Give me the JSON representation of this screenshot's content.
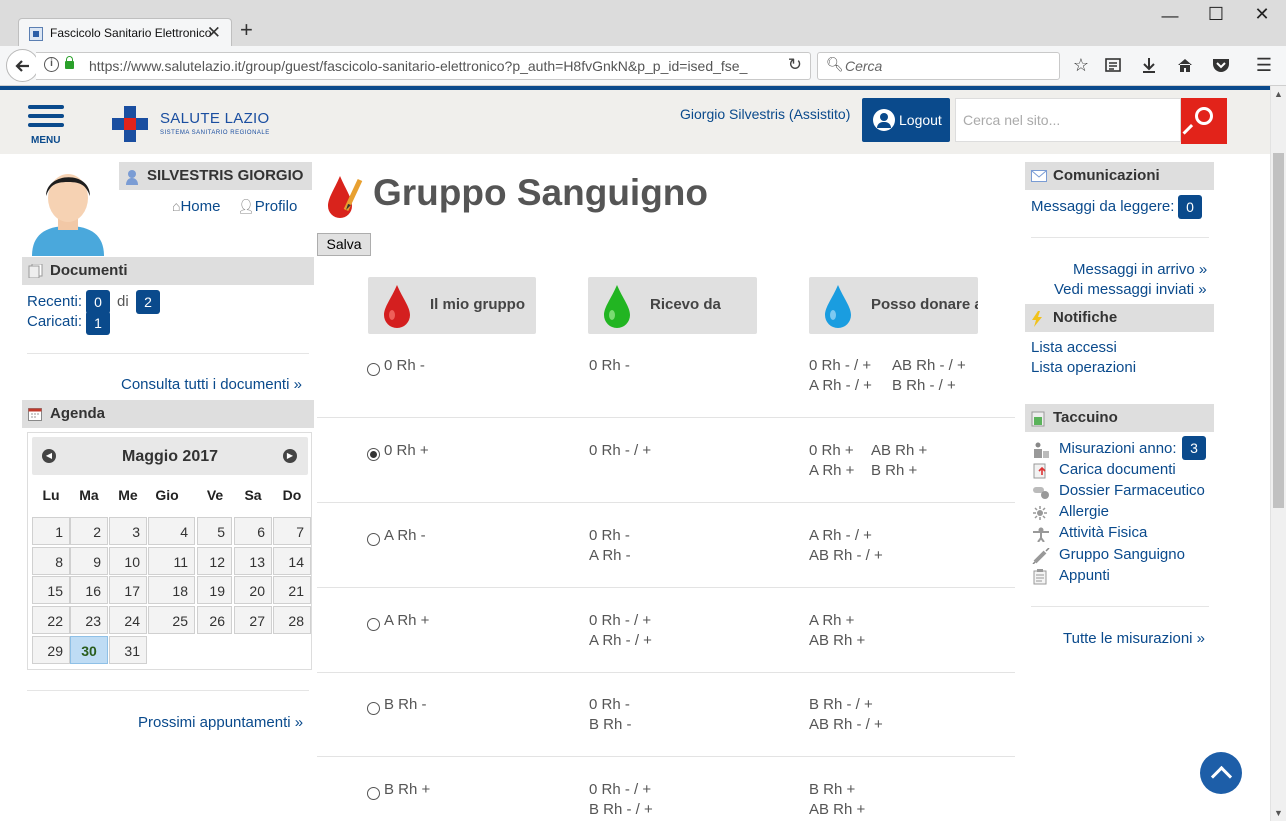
{
  "browser": {
    "tab_title": "Fascicolo Sanitario Elettronico",
    "new_tab": "+",
    "url": "https://www.salutelazio.it/group/guest/fascicolo-sanitario-elettronico?p_auth=H8fvGnkN&p_p_id=ised_fse_",
    "search_placeholder": "Cerca",
    "window_controls": [
      "minimize",
      "maximize",
      "close"
    ]
  },
  "header": {
    "menu_label": "MENU",
    "logo_title": "SALUTE LAZIO",
    "logo_subtitle": "SISTEMA SANITARIO REGIONALE",
    "user_name": "Giorgio Silvestris (Assistito)",
    "logout_label": "Logout",
    "site_search_placeholder": "Cerca nel sito..."
  },
  "profile": {
    "name": "SILVESTRIS GIORGIO",
    "home_link": "Home",
    "profile_link": "Profilo"
  },
  "documenti": {
    "title": "Documenti",
    "recent_label": "Recenti:",
    "recent_count": "0",
    "of_label": "di",
    "total_count": "2",
    "uploaded_label": "Caricati:",
    "uploaded_count": "1",
    "all_link": "Consulta tutti i documenti »"
  },
  "agenda": {
    "title": "Agenda",
    "month": "Maggio 2017",
    "weekdays": [
      "Lu",
      "Ma",
      "Me",
      "Gio",
      "Ve",
      "Sa",
      "Do"
    ],
    "weeks": [
      [
        "1",
        "2",
        "3",
        "4",
        "5",
        "6",
        "7"
      ],
      [
        "8",
        "9",
        "10",
        "11",
        "12",
        "13",
        "14"
      ],
      [
        "15",
        "16",
        "17",
        "18",
        "19",
        "20",
        "21"
      ],
      [
        "22",
        "23",
        "24",
        "25",
        "26",
        "27",
        "28"
      ],
      [
        "29",
        "30",
        "31"
      ]
    ],
    "today": "30",
    "next_link": "Prossimi appuntamenti »"
  },
  "main": {
    "title": "Gruppo Sanguigno",
    "save_button": "Salva",
    "columns": [
      "Il mio gruppo",
      "Ricevo da",
      "Posso donare a"
    ],
    "rows": [
      {
        "group": "0 Rh -",
        "receive": [
          "0 Rh -"
        ],
        "donate": [
          "0 Rh - / +",
          "AB Rh - / +",
          "A Rh - / +",
          "B Rh - / +"
        ],
        "selected": false
      },
      {
        "group": "0 Rh +",
        "receive": [
          "0 Rh - / +"
        ],
        "donate": [
          "0 Rh +",
          "AB Rh +",
          "A Rh +",
          "B Rh +"
        ],
        "selected": true
      },
      {
        "group": "A Rh -",
        "receive": [
          "0 Rh -",
          "A Rh -"
        ],
        "donate": [
          "A Rh - / +",
          "AB Rh - / +"
        ],
        "selected": false
      },
      {
        "group": "A Rh +",
        "receive": [
          "0 Rh - / +",
          "A Rh - / +"
        ],
        "donate": [
          "A Rh +",
          "AB Rh +"
        ],
        "selected": false
      },
      {
        "group": "B Rh -",
        "receive": [
          "0 Rh -",
          "B Rh -"
        ],
        "donate": [
          "B Rh - / +",
          "AB Rh - / +"
        ],
        "selected": false
      },
      {
        "group": "B Rh +",
        "receive": [
          "0 Rh - / +",
          "B Rh - / +"
        ],
        "donate": [
          "B Rh +",
          "AB Rh +"
        ],
        "selected": false
      }
    ]
  },
  "comunicazioni": {
    "title": "Comunicazioni",
    "unread_label": "Messaggi da leggere:",
    "unread_count": "0",
    "inbox_link": "Messaggi in arrivo »",
    "sent_link": "Vedi messaggi inviati »"
  },
  "notifiche": {
    "title": "Notifiche",
    "access_link": "Lista accessi",
    "operations_link": "Lista operazioni"
  },
  "taccuino": {
    "title": "Taccuino",
    "items": [
      {
        "label": "Misurazioni anno:",
        "icon": "measurements-icon",
        "count": "3"
      },
      {
        "label": "Carica documenti",
        "icon": "upload-documents-icon"
      },
      {
        "label": "Dossier Farmaceutico",
        "icon": "pills-icon"
      },
      {
        "label": "Allergie",
        "icon": "allergy-icon"
      },
      {
        "label": "Attività Fisica",
        "icon": "exercise-icon"
      },
      {
        "label": "Gruppo Sanguigno",
        "icon": "syringe-icon"
      },
      {
        "label": "Appunti",
        "icon": "notes-icon"
      }
    ],
    "all_link": "Tutte le misurazioni »"
  },
  "colors": {
    "brand_blue": "#0a4a8c",
    "brand_red": "#e2231a",
    "header_bg": "#f0efec"
  }
}
